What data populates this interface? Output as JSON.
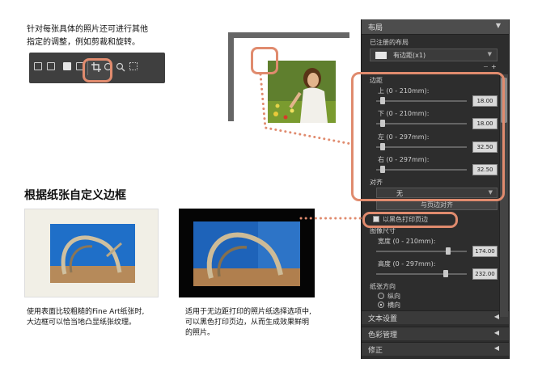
{
  "top_caption": {
    "line1": "针对每张具体的照片还可进行其他",
    "line2": "指定的调整，例如剪裁和旋转。"
  },
  "toolbar_icons": [
    "photo-icon",
    "photo-stack-icon",
    "text-icon",
    "image-icon",
    "crop-icon",
    "rotate-icon",
    "zoom-icon",
    "grid-icon"
  ],
  "heading": "根据纸张自定义边框",
  "caption_paper": {
    "line1": "使用表面比较粗糙的Fine Art纸张时,",
    "line2": "大边框可以恰当地凸显纸张纹理。"
  },
  "caption_black": {
    "line1": "适用于无边距打印的照片纸选择选项中,",
    "line2": "可以黑色打印页边，从而生成效果鲜明",
    "line3": "的照片。"
  },
  "panel": {
    "title": "布局",
    "registered_layout_label": "已注册的布局",
    "preset_value": "有边距(x1)",
    "margins_label": "边距",
    "margins": [
      {
        "label": "上 (0 - 210mm):",
        "value": "18.00",
        "position": 0.05
      },
      {
        "label": "下 (0 - 210mm):",
        "value": "18.00",
        "position": 0.05
      },
      {
        "label": "左 (0 - 297mm):",
        "value": "32.50",
        "position": 0.05
      },
      {
        "label": "右 (0 - 297mm):",
        "value": "32.50",
        "position": 0.05
      }
    ],
    "align_label": "对齐",
    "align_value": "无",
    "align_button": "与页边对齐",
    "black_margin_checkbox": "以黑色打印页边",
    "image_size_label": "图像尺寸",
    "width_label": "宽度 (0 - 210mm):",
    "width_value": "174.00",
    "height_label": "高度 (0 - 297mm):",
    "height_value": "232.00",
    "orientation_label": "纸张方向",
    "orientation_portrait": "纵向",
    "orientation_landscape": "横向",
    "sections": [
      "文本设置",
      "色彩管理",
      "修正"
    ]
  },
  "colors": {
    "accent": "#e08b6e",
    "panel_bg": "#2d2d2d",
    "panel_header": "#4d4d4d"
  }
}
